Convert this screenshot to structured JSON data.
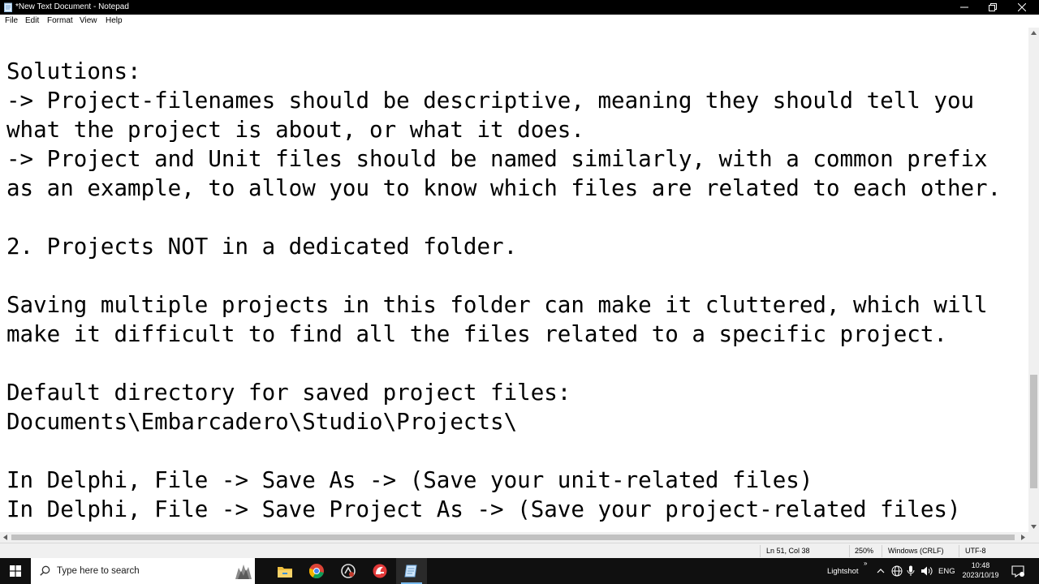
{
  "window": {
    "title": "*New Text Document - Notepad"
  },
  "menu": {
    "file": "File",
    "edit": "Edit",
    "format": "Format",
    "view": "View",
    "help": "Help"
  },
  "document": {
    "text": "Solutions:\n-> Project-filenames should be descriptive, meaning they should tell you\nwhat the project is about, or what it does.\n-> Project and Unit files should be named similarly, with a common prefix\nas an example, to allow you to know which files are related to each other.\n\n2. Projects NOT in a dedicated folder.\n\nSaving multiple projects in this folder can make it cluttered, which will\nmake it difficult to find all the files related to a specific project.\n\nDefault directory for saved project files:\nDocuments\\Embarcadero\\Studio\\Projects\\\n\nIn Delphi, File -> Save As -> (Save your unit-related files)\nIn Delphi, File -> Save Project As -> (Save your project-related files)"
  },
  "status": {
    "position": "Ln 51, Col 38",
    "zoom": "250%",
    "line_ending": "Windows (CRLF)",
    "encoding": "UTF-8"
  },
  "taskbar": {
    "search_placeholder": "Type here to search",
    "tray_app": "Lightshot",
    "language": "ENG",
    "time": "10:48",
    "date": "2023/10/19"
  },
  "colors": {
    "titlebar": "#000000",
    "taskbar": "#101010",
    "statusbar": "#f0f0f0",
    "accent": "#76b9ed"
  }
}
